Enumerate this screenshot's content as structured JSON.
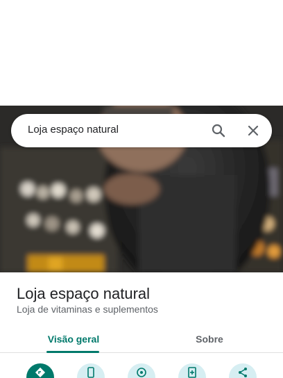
{
  "search": {
    "query": "Loja espaço natural"
  },
  "place": {
    "name": "Loja espaço natural",
    "category": "Loja de vitaminas e suplementos"
  },
  "tabs": [
    {
      "label": "Visão geral",
      "active": true
    },
    {
      "label": "Sobre",
      "active": false
    }
  ],
  "actions": [
    {
      "icon": "directions-icon"
    },
    {
      "icon": "phone-icon"
    },
    {
      "icon": "location-icon"
    },
    {
      "icon": "save-icon"
    },
    {
      "icon": "share-icon"
    }
  ],
  "colors": {
    "accent": "#00796b",
    "action_bg": "#d6eef2"
  }
}
